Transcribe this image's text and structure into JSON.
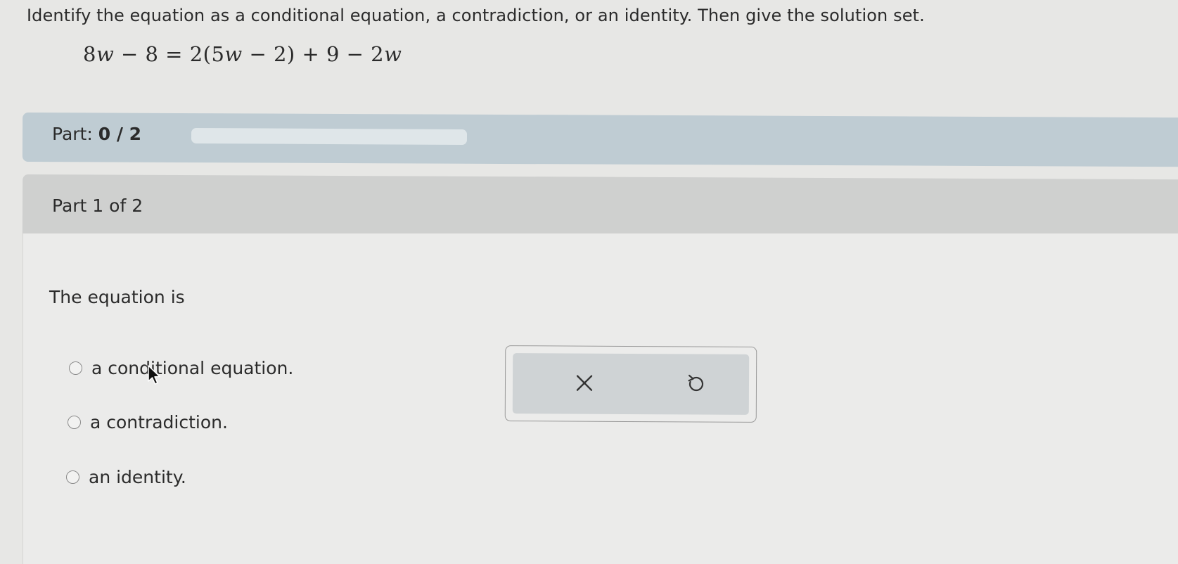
{
  "question": {
    "instruction": "Identify the equation as a conditional equation, a contradiction, or an identity. Then give the solution set.",
    "equation": {
      "lhs_coef": "8",
      "lhs_var": "w",
      "lhs_rest": " − 8 = 2(5",
      "inner_var": "w",
      "rhs_rest": " − 2) + 9 − 2",
      "rhs_var": "w"
    }
  },
  "progress": {
    "label": "Part:",
    "value_text": "0 / 2",
    "fraction_complete": 0,
    "fill_color": "#6d9bb5"
  },
  "part": {
    "title": "Part 1 of 2",
    "prompt": "The equation is",
    "options": [
      {
        "label": "a conditional equation.",
        "selected": false
      },
      {
        "label": "a contradiction.",
        "selected": false
      },
      {
        "label": "an identity.",
        "selected": false
      }
    ]
  },
  "tools": {
    "clear_icon": "close-icon",
    "undo_icon": "undo-icon"
  },
  "colors": {
    "progress_band": "#bfccd3",
    "part_header": "#cfd0cf",
    "tool_panel": "#cfd3d5"
  }
}
